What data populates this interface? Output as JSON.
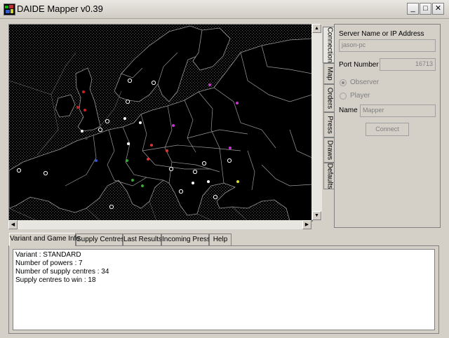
{
  "window": {
    "title": "DAIDE Mapper v0.39",
    "minimize_glyph": "_",
    "maximize_glyph": "□",
    "close_glyph": "✕"
  },
  "side_tabs": [
    {
      "label": "Connection",
      "active": true
    },
    {
      "label": "Map",
      "active": false
    },
    {
      "label": "Orders",
      "active": false
    },
    {
      "label": "Press",
      "active": false
    },
    {
      "label": "Draws",
      "active": false
    },
    {
      "label": "Defaults",
      "active": false
    }
  ],
  "connection": {
    "server_label": "Server Name or IP Address",
    "server_value": "jason-pc",
    "port_label": "Port Number",
    "port_value": "16713",
    "observer_label": "Observer",
    "player_label": "Player",
    "name_label": "Name",
    "name_value": "Mapper",
    "connect_label": "Connect"
  },
  "bottom_tabs": [
    {
      "label": "Variant and Game Info",
      "active": true
    },
    {
      "label": "Supply Centres",
      "active": false
    },
    {
      "label": "Last Results",
      "active": false
    },
    {
      "label": "Incoming Press",
      "active": false
    },
    {
      "label": "Help",
      "active": false
    }
  ],
  "info_lines": [
    "Variant : STANDARD",
    "Number of powers : 7",
    "Number of supply centres : 34",
    "Supply centres to win : 18"
  ],
  "colors": {
    "neutral": "#ffffff",
    "england": "#cc2222",
    "russia": "#cc33cc",
    "austria": "#dd3333",
    "germany": "#444444",
    "italy": "#33aa33",
    "france": "#3355cc",
    "turkey": "#dddd33"
  }
}
